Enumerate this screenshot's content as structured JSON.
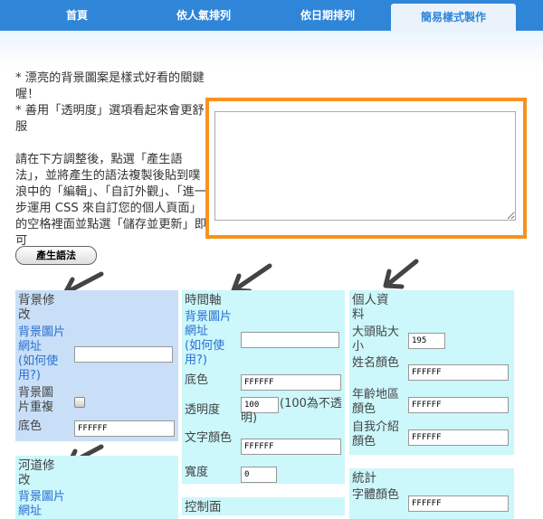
{
  "nav": {
    "tabs": [
      {
        "label": "首頁"
      },
      {
        "label": "依人氣排列"
      },
      {
        "label": "依日期排列"
      },
      {
        "label": "簡易樣式製作"
      }
    ]
  },
  "intro": {
    "tip1": "* 漂亮的背景圖案是樣式好看的關鍵喔！",
    "tip2": "* 善用「透明度」選項看起來會更舒服",
    "instructions": "請在下方調整後，點選「產生語法」，並將產生的語法複製後貼到噗浪中的「編輯」、「自訂外觀」、「進一步運用 CSS 來自訂您的個人頁面」的空格裡面並點選「儲存並更新」即可"
  },
  "generate_button": "產生語法",
  "background": {
    "title": "背景修改",
    "image_url_label": "背景圖片網址",
    "how_to_label": "(如何使用?)",
    "image_repeat_label": "背景圖片重複",
    "bg_color_label": "底色",
    "bg_color_value": "FFFFFF"
  },
  "timeline": {
    "title": "時間軸",
    "image_url_label": "背景圖片網址",
    "how_to_label": "(如何使用?)",
    "bg_color_label": "底色",
    "bg_color_value": "FFFFFF",
    "opacity_label": "透明度",
    "opacity_value": "100",
    "opacity_hint": "(100為不透明)",
    "text_color_label": "文字顏色",
    "text_color_value": "FFFFFF",
    "width_label": "寬度",
    "width_value": "0"
  },
  "profile": {
    "title": "個人資料",
    "avatar_size_label": "大頭貼大小",
    "avatar_size_value": "195",
    "name_color_label": "姓名顏色",
    "name_color_value": "FFFFFF",
    "age_location_color_label": "年齡地區顏色",
    "age_location_color_value": "FFFFFF",
    "bio_color_label": "自我介紹顏色",
    "bio_color_value": "FFFFFF"
  },
  "river": {
    "title": "河道修改",
    "image_url_label": "背景圖片網址"
  },
  "stats": {
    "title": "統計",
    "font_color_label": "字體顏色",
    "font_color_value": "FFFFFF"
  },
  "control": {
    "title": "控制面"
  }
}
